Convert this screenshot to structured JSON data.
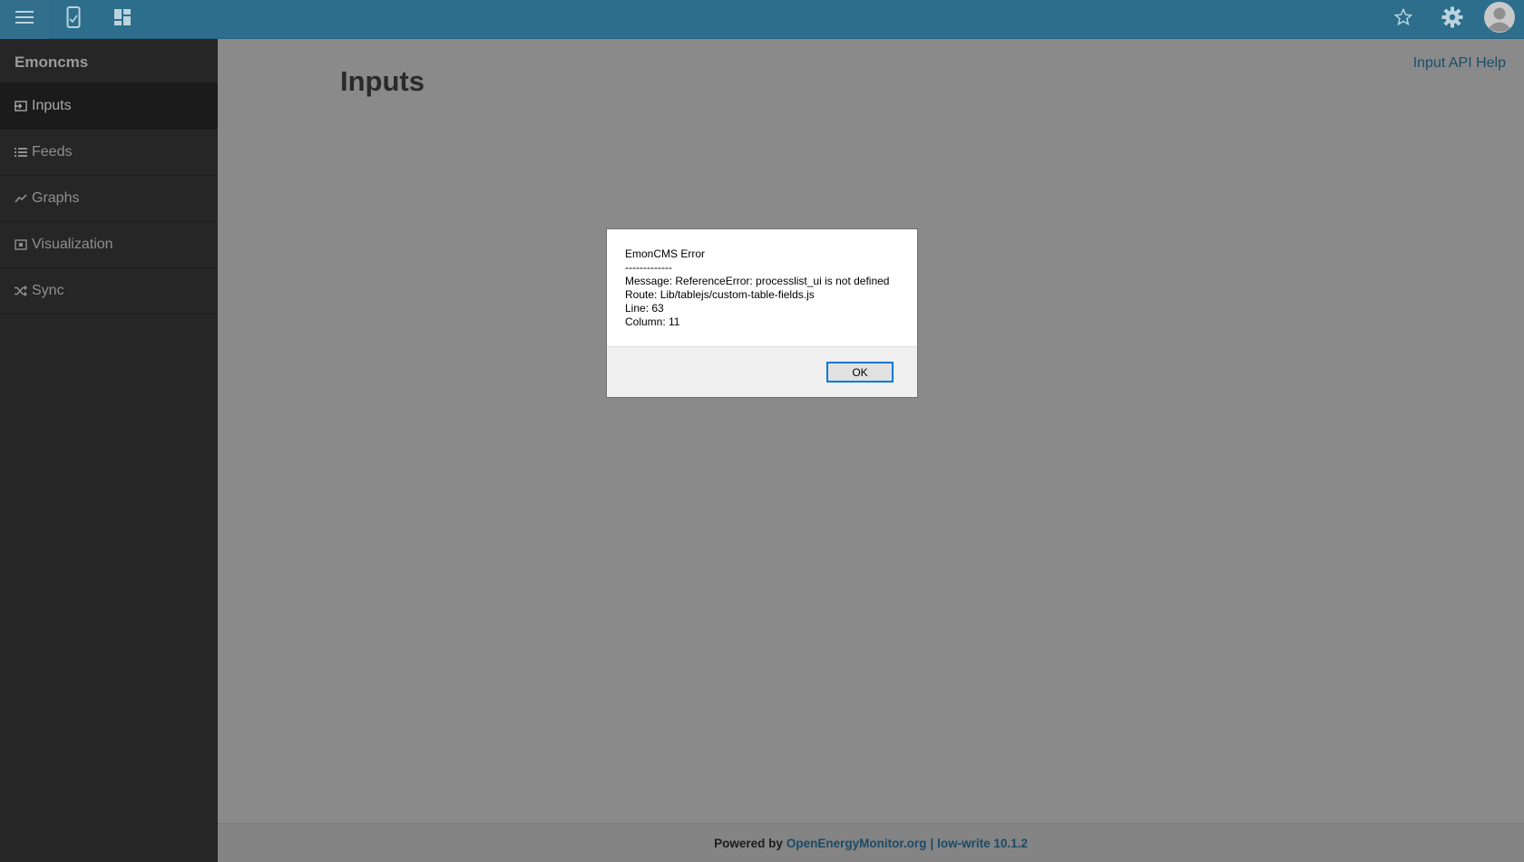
{
  "topbar": {
    "icons": [
      "menu-icon",
      "phone-icon",
      "dashboard-icon",
      "star-icon",
      "gear-icon",
      "user-avatar-icon"
    ]
  },
  "sidebar": {
    "brand": "Emoncms",
    "items": [
      {
        "label": "Inputs",
        "icon": "input-icon",
        "active": true
      },
      {
        "label": "Feeds",
        "icon": "list-icon"
      },
      {
        "label": "Graphs",
        "icon": "line-chart-icon"
      },
      {
        "label": "Visualization",
        "icon": "visualization-icon"
      },
      {
        "label": "Sync",
        "icon": "shuffle-icon"
      }
    ]
  },
  "main": {
    "title": "Inputs",
    "help_link": "Input API Help"
  },
  "footer": {
    "powered_by": "Powered by",
    "link": "OpenEnergyMonitor.org",
    "separator": "|",
    "version": "low-write 10.1.2"
  },
  "dialog": {
    "title": "EmonCMS Error",
    "divider": "-------------",
    "message": "Message: ReferenceError: processlist_ui is not defined",
    "route": "Route: Lib/tablejs/custom-table-fields.js",
    "line": "Line: 63",
    "column": "Column: 11",
    "ok_label": "OK"
  },
  "colors": {
    "topbar": "#2c6e8c",
    "sidebar": "#262626",
    "overlay_bg": "#8a8a8a",
    "link": "#1b4d68"
  }
}
